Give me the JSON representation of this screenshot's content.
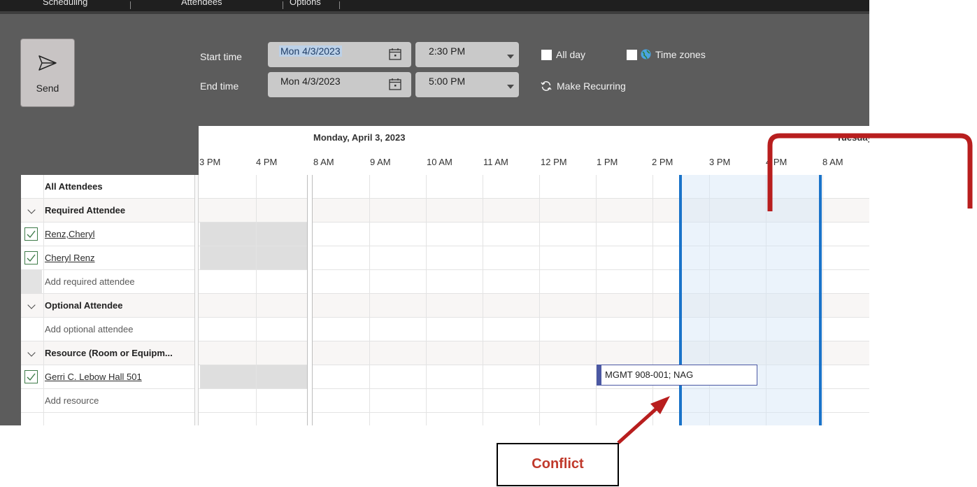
{
  "tabs": [
    "Scheduling",
    "Attendees",
    "Options"
  ],
  "send": {
    "label": "Send"
  },
  "start": {
    "label": "Start time",
    "date": "Mon 4/3/2023",
    "time": "2:30 PM"
  },
  "end": {
    "label": "End time",
    "date": "Mon 4/3/2023",
    "time": "5:00 PM"
  },
  "options": {
    "all_day": "All day",
    "time_zones": "Time zones",
    "recurring": "Make Recurring"
  },
  "timeline": {
    "date": "Monday, April 3, 2023",
    "next_date": "Tuesday,",
    "hours": [
      "3 PM",
      "4 PM",
      "8 AM",
      "9 AM",
      "10 AM",
      "11 AM",
      "12 PM",
      "1 PM",
      "2 PM",
      "3 PM",
      "4 PM",
      "8 AM"
    ]
  },
  "attendees": {
    "all": "All Attendees",
    "required_header": "Required Attendee",
    "required": [
      "Renz,Cheryl",
      "Cheryl Renz"
    ],
    "add_required": "Add required attendee",
    "optional_header": "Optional Attendee",
    "add_optional": "Add optional attendee",
    "resource_header": "Resource (Room or Equipm...",
    "resources": [
      "Gerri C. Lebow Hall 501"
    ],
    "add_resource": "Add resource"
  },
  "appointment": {
    "text": "MGMT 908-001; NAG"
  },
  "annotation": {
    "label": "Conflict",
    "color": "#c0392b"
  },
  "colors": {
    "accent": "#1a73c9",
    "ribbon": "#5c5c5c",
    "busy": "#dedede",
    "appointment": "#4b58a3"
  }
}
